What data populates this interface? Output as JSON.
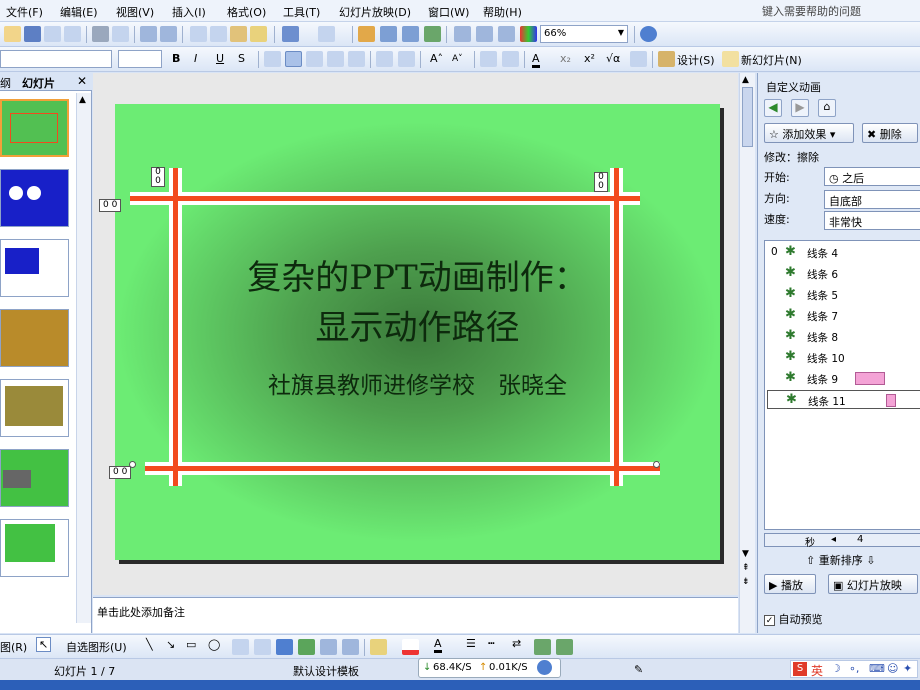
{
  "menu": {
    "items": [
      "文件(F)",
      "编辑(E)",
      "视图(V)",
      "插入(I)",
      "格式(O)",
      "工具(T)",
      "幻灯片放映(D)",
      "窗口(W)",
      "帮助(H)"
    ],
    "help_placeholder": "键入需要帮助的问题"
  },
  "toolbar": {
    "zoom": "66%",
    "design_label": "设计(S)",
    "new_slide_label": "新幻灯片(N)"
  },
  "left_pane": {
    "tab_outline": "纲",
    "tab_slides": "幻灯片"
  },
  "slide": {
    "title_line1": "复杂的PPT动画制作：",
    "title_line2": "显示动作路径",
    "subtitle": "社旗县教师进修学校　张晓全",
    "tag_00": "0 0"
  },
  "notes": {
    "placeholder": "单击此处添加备注"
  },
  "task_pane": {
    "title": "自定义动画",
    "add_effect": "添加效果",
    "delete": "删除",
    "modify": "修改：擦除",
    "start_label": "开始:",
    "start_value": "之后",
    "direction_label": "方向:",
    "direction_value": "自底部",
    "speed_label": "速度:",
    "speed_value": "非常快",
    "items": [
      {
        "index": "0",
        "label": "线条 4"
      },
      {
        "index": "",
        "label": "线条 6"
      },
      {
        "index": "",
        "label": "线条 5"
      },
      {
        "index": "",
        "label": "线条 7"
      },
      {
        "index": "",
        "label": "线条 8"
      },
      {
        "index": "",
        "label": "线条 10"
      },
      {
        "index": "",
        "label": "线条 9"
      },
      {
        "index": "",
        "label": "线条 11"
      }
    ],
    "timeline_unit": "秒",
    "timeline_start": "4",
    "reorder": "重新排序",
    "play": "播放",
    "slideshow": "幻灯片放映",
    "autopreview": "自动预览"
  },
  "drawbar": {
    "draw_label": "图(R)",
    "autoshape_label": "自选图形(U)"
  },
  "status": {
    "slide_info": "幻灯片 1 / 7",
    "template": "默认设计模板",
    "down_speed": "68.4K/S",
    "up_speed": "0.01K/S",
    "ime": "英"
  },
  "colors": {
    "slide_green": "#6cec74",
    "line_red": "#f24a1e",
    "anim_bar": "#f4a3d6"
  }
}
